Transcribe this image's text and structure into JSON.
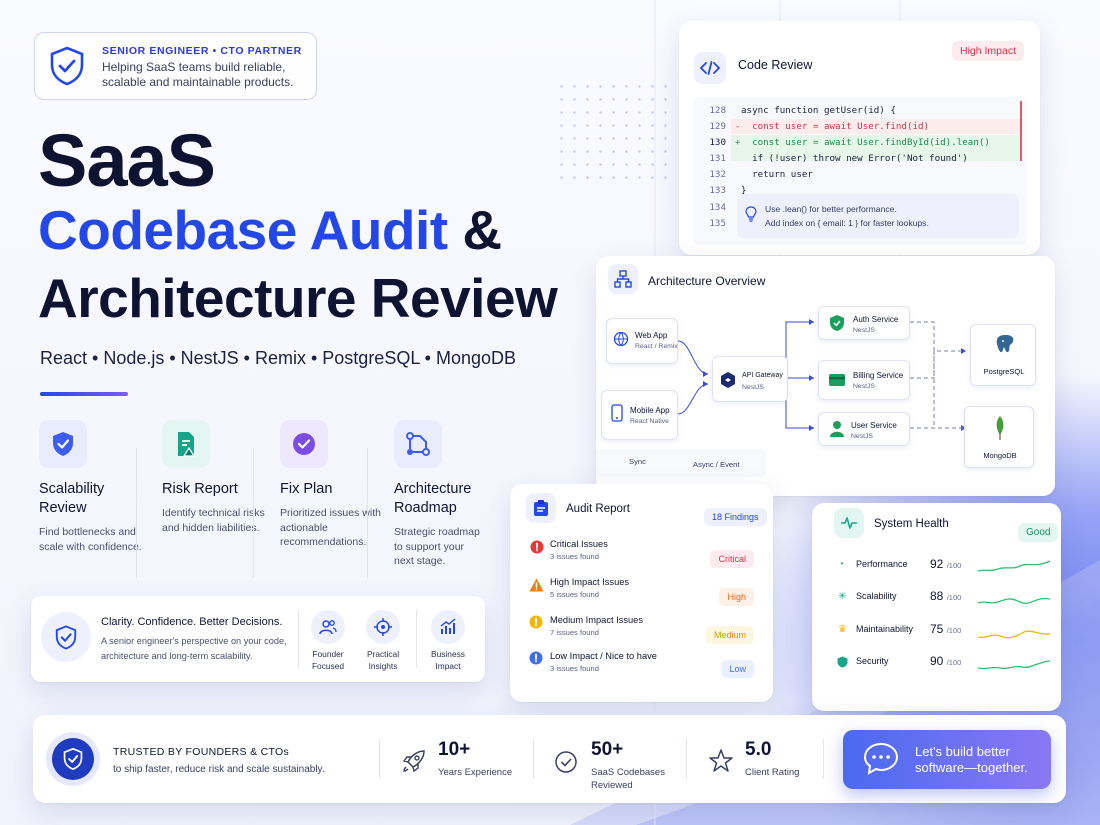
{
  "badge": {
    "kicker": "SENIOR ENGINEER • CTO PARTNER",
    "subtitle": "Helping SaaS teams build reliable, scalable and maintainable products.",
    "icon": "shield-check-icon"
  },
  "headline": {
    "line1": "SaaS",
    "line2": "Codebase Audit",
    "amp": " &",
    "line3": "Architecture Review"
  },
  "tech_stack": "React  •  Node.js  •  NestJS  •  Remix  •  PostgreSQL  •  MongoDB",
  "features": [
    {
      "title": "Scalability Review",
      "desc": "Find bottlenecks and scale with confidence.",
      "icon": "shield-check-icon"
    },
    {
      "title": "Risk Report",
      "desc": "Identify technical risks and hidden liabilities.",
      "icon": "document-alert-icon"
    },
    {
      "title": "Fix Plan",
      "desc": "Prioritized issues with actionable recommendations.",
      "icon": "check-circle-icon"
    },
    {
      "title": "Architecture Roadmap",
      "desc": "Strategic roadmap to support your next stage.",
      "icon": "roadmap-icon"
    }
  ],
  "clarity": {
    "title": "Clarity. Confidence. Better Decisions.",
    "desc": "A senior engineer's perspective on your code, architecture and long-term scalability.",
    "items": [
      {
        "label": "Founder Focused",
        "icon": "users-icon"
      },
      {
        "label": "Practical Insights",
        "icon": "target-icon"
      },
      {
        "label": "Business Impact",
        "icon": "chart-up-icon"
      }
    ]
  },
  "code_review": {
    "title": "Code Review",
    "badge": "High Impact",
    "lines": [
      {
        "num": "128",
        "marker": "",
        "code": "async function getUser(id) {"
      },
      {
        "num": "129",
        "marker": "-",
        "code": "  const user = await User.find(id)"
      },
      {
        "num": "130",
        "marker": "+",
        "code": "  const user = await User.findById(id).lean()"
      },
      {
        "num": "131",
        "marker": "",
        "code": "  if (!user) throw new Error('Not found')"
      },
      {
        "num": "132",
        "marker": "",
        "code": "  return user"
      },
      {
        "num": "133",
        "marker": "",
        "code": "}"
      },
      {
        "num": "134",
        "marker": "",
        "code": ""
      },
      {
        "num": "135",
        "marker": "",
        "code": ""
      }
    ],
    "tip1": "Use .lean() for better performance.",
    "tip2": "Add index on { email: 1 } for faster lookups."
  },
  "architecture": {
    "title": "Architecture Overview",
    "clients": [
      {
        "name": "Web App",
        "sub": "React / Remix",
        "icon": "globe-icon"
      },
      {
        "name": "Mobile App",
        "sub": "React Native",
        "icon": "phone-icon"
      }
    ],
    "gateway": {
      "name": "API Gateway",
      "sub": "NestJS"
    },
    "services": [
      {
        "name": "Auth Service",
        "sub": "NestJS",
        "icon": "shield-icon"
      },
      {
        "name": "Billing Service",
        "sub": "NestJS",
        "icon": "card-icon"
      },
      {
        "name": "User Service",
        "sub": "NestJS",
        "icon": "user-icon"
      }
    ],
    "databases": [
      {
        "name": "PostgreSQL",
        "icon": "postgresql-icon"
      },
      {
        "name": "MongoDB",
        "icon": "mongodb-icon"
      }
    ],
    "legend_sync": "Sync",
    "legend_async": "Async / Event"
  },
  "audit_report": {
    "title": "Audit Report",
    "badge": "18 Findings",
    "rows": [
      {
        "title": "Critical Issues",
        "count": "3 issues found",
        "level": "Critical",
        "color": "#e53935"
      },
      {
        "title": "High Impact Issues",
        "count": "5 issues found",
        "level": "High",
        "color": "#f57c00"
      },
      {
        "title": "Medium Impact Issues",
        "count": "7 issues found",
        "level": "Medium",
        "color": "#f2b705"
      },
      {
        "title": "Low Impact / Nice to have",
        "count": "3 issues found",
        "level": "Low",
        "color": "#3f6ee8"
      }
    ]
  },
  "system_health": {
    "title": "System Health",
    "status": "Good",
    "metrics": [
      {
        "name": "Performance",
        "value": "92",
        "max": "/100",
        "color": "#2fbf71"
      },
      {
        "name": "Scalability",
        "value": "88",
        "max": "/100",
        "color": "#2fbf71"
      },
      {
        "name": "Maintainability",
        "value": "75",
        "max": "/100",
        "color": "#f2b705"
      },
      {
        "name": "Security",
        "value": "90",
        "max": "/100",
        "color": "#2fbf71"
      }
    ]
  },
  "trust": {
    "title": "TRUSTED BY FOUNDERS & CTOs",
    "sub": "to ship faster, reduce risk and scale sustainably.",
    "stats": [
      {
        "value": "10+",
        "label": "Years Experience",
        "icon": "rocket-icon"
      },
      {
        "value": "50+",
        "label": "SaaS Codebases Reviewed",
        "icon": "check-circle-icon"
      },
      {
        "value": "5.0",
        "label": "Client Rating",
        "icon": "star-icon"
      }
    ],
    "cta": "Let's build better software—together."
  },
  "colors": {
    "primary": "#2448e8",
    "dark": "#0e1331",
    "accent": "#7b5cf2"
  }
}
